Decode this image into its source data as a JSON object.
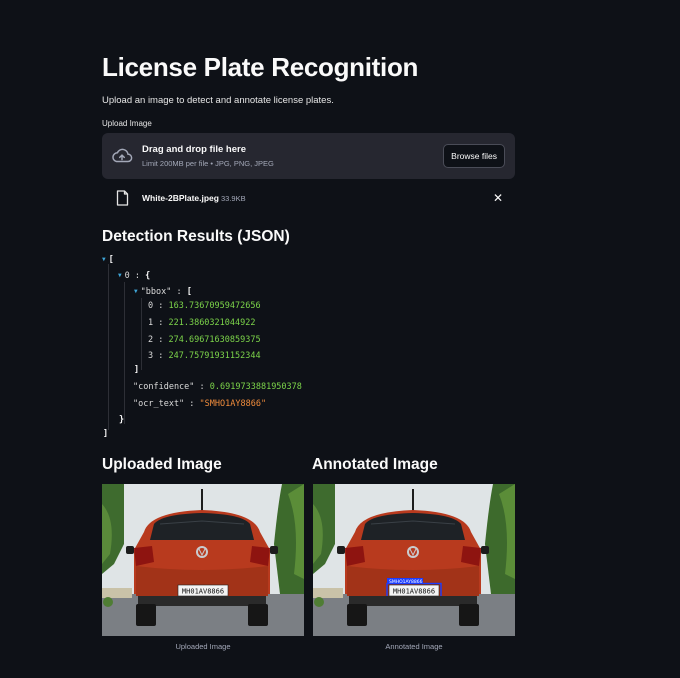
{
  "page": {
    "title": "License Plate Recognition",
    "subtitle": "Upload an image to detect and annotate license plates."
  },
  "uploader": {
    "label": "Upload Image",
    "drop_title": "Drag and drop file here",
    "limit_text": "Limit 200MB per file • JPG, PNG, JPEG",
    "browse_label": "Browse files",
    "file_name": "White-2BPlate.jpeg",
    "file_size": "33.9KB"
  },
  "results": {
    "heading": "Detection Results (JSON)",
    "open_bracket": "[",
    "close_bracket": "]",
    "item_index": "0",
    "open_brace": "{",
    "close_brace": "}",
    "bbox_key": "\"bbox\"",
    "bbox_open": "[",
    "bbox_close": "]",
    "bbox": [
      {
        "index": "0",
        "value": "163.73670959472656"
      },
      {
        "index": "1",
        "value": "221.3860321044922"
      },
      {
        "index": "2",
        "value": "274.69671630859375"
      },
      {
        "index": "3",
        "value": "247.75791931152344"
      }
    ],
    "confidence_key": "\"confidence\"",
    "confidence_value": "0.6919733881950378",
    "ocr_key": "\"ocr_text\"",
    "ocr_value": "\"SMHO1AY8866\""
  },
  "images": {
    "uploaded_heading": "Uploaded Image",
    "annotated_heading": "Annotated Image",
    "uploaded_caption": "Uploaded Image",
    "annotated_caption": "Annotated Image",
    "plate_text": "MH01AV8866",
    "annotation_label": "SMHO1AY8866",
    "annotation_color": "#1a3cff"
  },
  "colors": {
    "background": "#0e1117",
    "dropzone": "#262730",
    "number": "#7cd44a",
    "string": "#f08c3c",
    "arrow": "#3fa6d8"
  }
}
